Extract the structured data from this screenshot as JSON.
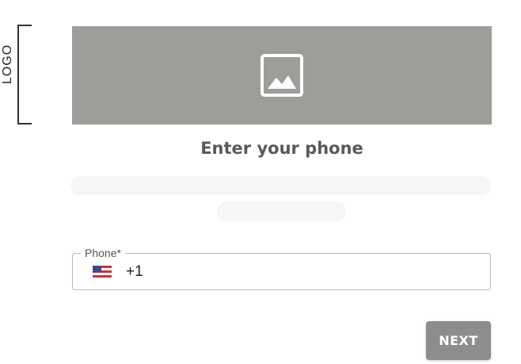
{
  "logo": {
    "text": "LOGO"
  },
  "hero": {
    "icon": "image-placeholder-icon",
    "background": "#9e9d9a"
  },
  "page": {
    "title": "Enter your phone"
  },
  "phone": {
    "label": "Phone*",
    "country_icon": "us-flag-icon",
    "value": "+1"
  },
  "actions": {
    "next_label": "NEXT"
  },
  "colors": {
    "button": "#8d8d8d",
    "placeholder": "#9e9d9a",
    "skeleton": "#f6f6f6"
  }
}
